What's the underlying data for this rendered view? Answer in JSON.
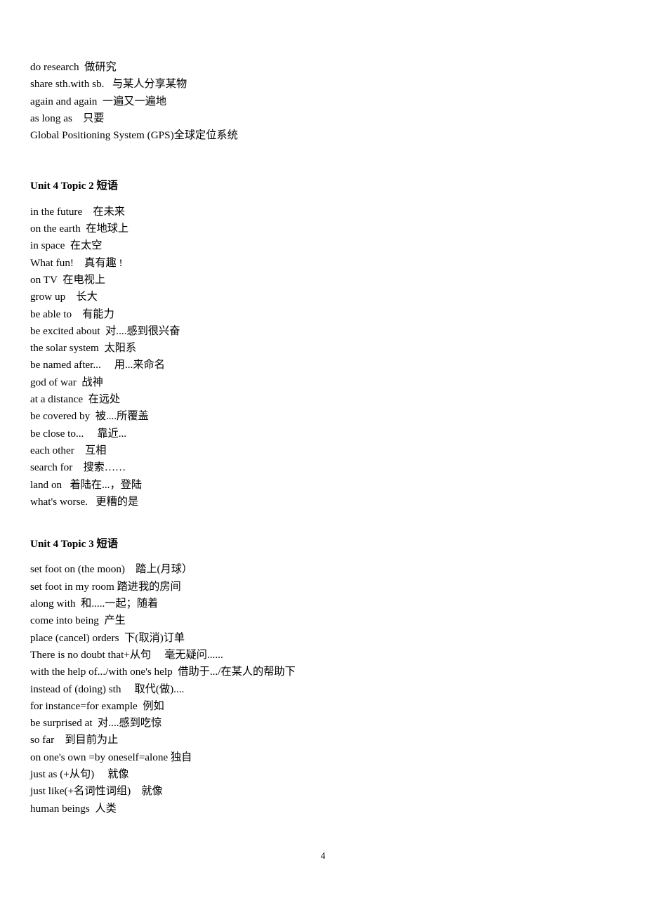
{
  "document": {
    "page_number": "4",
    "sections": [
      {
        "id": "intro-phrases",
        "heading": null,
        "lines": [
          "do research  做研究",
          "share sth.with sb.   与某人分享某物",
          "again and again  一遍又一遍地",
          "as long as    只要",
          "Global Positioning System (GPS)全球定位系统"
        ]
      },
      {
        "id": "unit4-topic2",
        "heading": "Unit 4 Topic 2 短语",
        "lines": [
          "in the future    在未来",
          "on the earth  在地球上",
          "in space  在太空",
          "What fun!    真有趣 !",
          "on TV  在电视上",
          "grow up    长大",
          "be able to    有能力",
          "be excited about  对....感到很兴奋",
          "the solar system  太阳系",
          "be named after...     用...来命名",
          "god of war  战神",
          "at a distance  在远处",
          "be covered by  被....所覆盖",
          "be close to...     靠近...",
          "each other    互相",
          "search for    搜索……",
          "land on   着陆在...，登陆",
          "what's worse.   更糟的是"
        ]
      },
      {
        "id": "unit4-topic3",
        "heading": "Unit 4 Topic 3 短语",
        "lines": [
          "set foot on (the moon)    踏上(月球）",
          "set foot in my room 踏进我的房间",
          "along with  和.....一起；随着",
          "come into being  产生",
          "place (cancel) orders  下(取消)订单",
          "There is no doubt that+从句     毫无疑问......",
          "with the help of.../with one's help  借助于.../在某人的帮助下",
          "instead of (doing) sth     取代(做)....",
          "for instance=for example  例如",
          "be surprised at  对....感到吃惊",
          "so far    到目前为止",
          "on one's own =by oneself=alone 独自",
          "just as (+从句)     就像",
          "just like(+名词性词组)    就像",
          "human beings  人类"
        ]
      }
    ]
  }
}
